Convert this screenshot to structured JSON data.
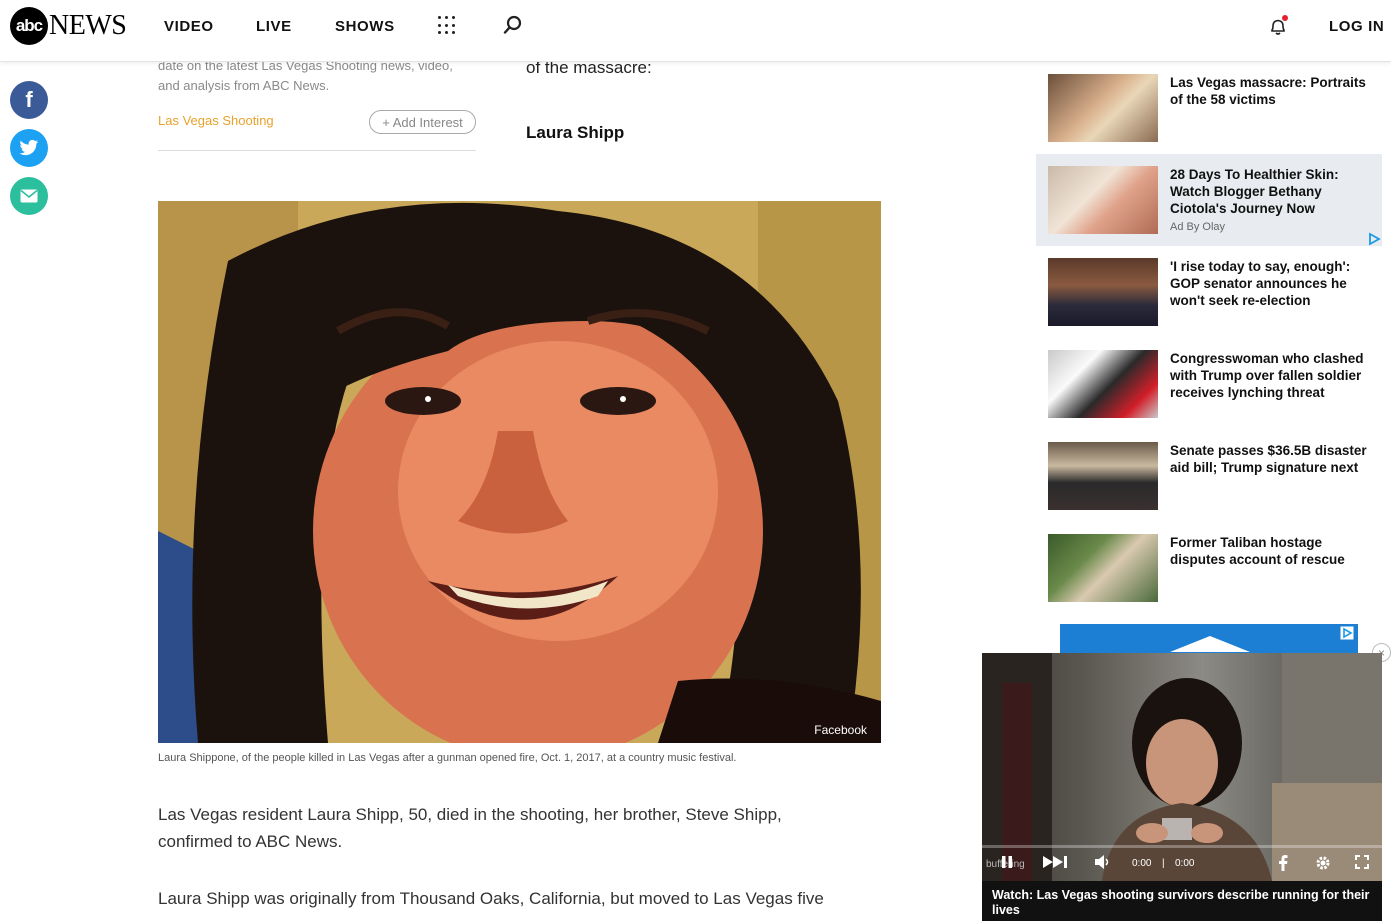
{
  "header": {
    "logo_abc": "abc",
    "logo_news": "NEWS",
    "nav": [
      "VIDEO",
      "LIVE",
      "SHOWS"
    ],
    "login": "LOG IN"
  },
  "social": {
    "facebook": "f"
  },
  "article": {
    "blurb": "date on the latest Las Vegas Shooting news, video, and analysis from ABC News.",
    "interest_link": "Las Vegas Shooting",
    "add_interest": "+ Add Interest",
    "massacre_text": "of the massacre:",
    "subhead": "Laura Shipp",
    "photo_credit": "Facebook",
    "caption": "Laura Shippone, of the people killed in Las Vegas after a gunman opened fire, Oct. 1, 2017, at a country music festival.",
    "paragraph1": "Las Vegas resident Laura Shipp, 50, died in the shooting, her brother, Steve Shipp, confirmed to ABC News.",
    "paragraph2": "Laura Shipp was originally from Thousand Oaks, California, but moved to Las Vegas five"
  },
  "sidebar": {
    "stories": [
      {
        "title": "Las Vegas massacre: Portraits of the 58 victims"
      },
      {
        "title": "28 Days To Healthier Skin: Watch Blogger Bethany Ciotola's Journey Now",
        "ad_label": "Ad By Olay"
      },
      {
        "title": "'I rise today to say, enough': GOP senator announces he won't seek re-election"
      },
      {
        "title": "Congresswoman who clashed with Trump over fallen soldier receives lynching threat"
      },
      {
        "title": "Senate passes $36.5B disaster aid bill; Trump signature next"
      },
      {
        "title": "Former Taliban hostage disputes account of rescue"
      }
    ]
  },
  "player": {
    "status": "buffering",
    "time_current": "0:00",
    "time_separator": "|",
    "time_total": "0:00",
    "title": "Watch: Las Vegas shooting survivors describe running for their lives"
  },
  "colors": {
    "facebook": "#3a5a98",
    "twitter": "#1da1f2",
    "email": "#2bbf9d",
    "interest": "#e8a22c",
    "ad_background": "#e8ecf0"
  }
}
